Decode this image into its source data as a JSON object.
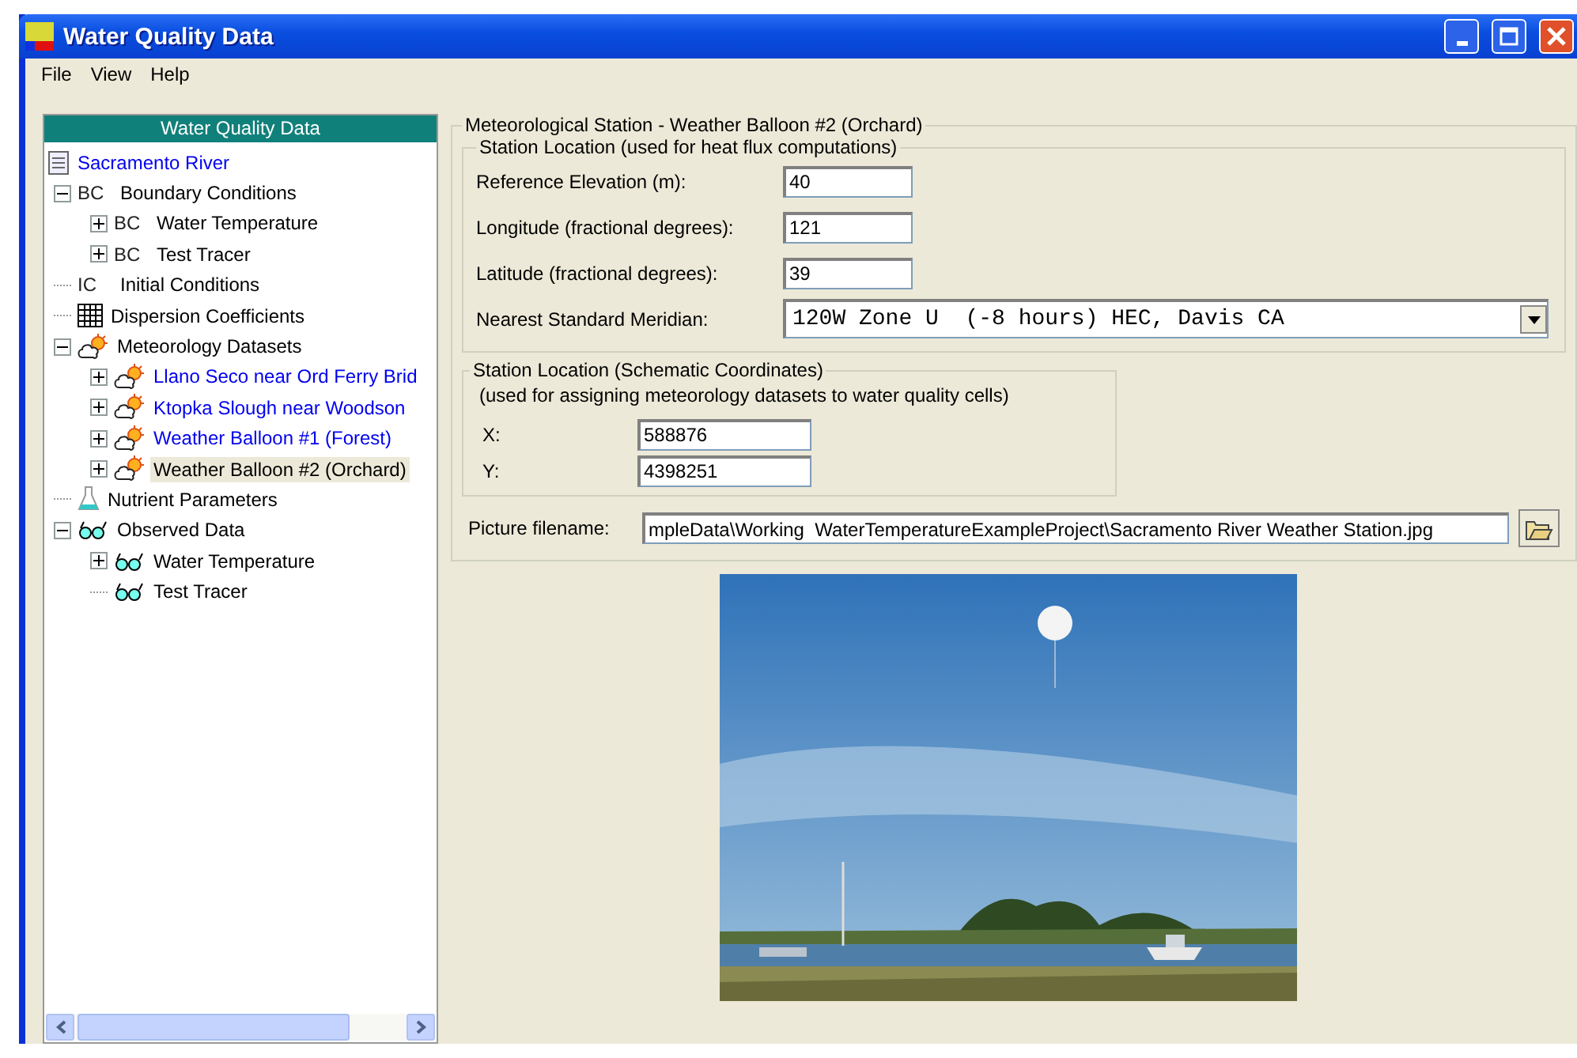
{
  "window": {
    "title": "Water Quality Data"
  },
  "menu": [
    "File",
    "View",
    "Help"
  ],
  "tree": {
    "title": "Water Quality Data",
    "items": [
      {
        "label": "Sacramento River",
        "kind": "document",
        "linked": true,
        "selected": false
      },
      {
        "label": "Boundary Conditions",
        "kind": "code",
        "badge": "BC",
        "linked": false,
        "selected": false,
        "expanded": true,
        "children": [
          {
            "label": "Water Temperature",
            "kind": "code",
            "badge": "BC",
            "linked": false,
            "selected": false,
            "expanded": false
          },
          {
            "label": "Test Tracer",
            "kind": "code",
            "badge": "BC",
            "linked": false,
            "selected": false,
            "expanded": false
          }
        ]
      },
      {
        "label": "Initial Conditions",
        "kind": "code",
        "badge": "IC",
        "linked": false,
        "selected": false
      },
      {
        "label": "Dispersion Coefficients",
        "kind": "grid",
        "linked": false,
        "selected": false
      },
      {
        "label": "Meteorology Datasets",
        "kind": "weather",
        "linked": false,
        "selected": false,
        "expanded": true,
        "children": [
          {
            "label": "Llano Seco near Ord Ferry Brid",
            "kind": "weather",
            "linked": true,
            "selected": false,
            "expanded": false
          },
          {
            "label": "Ktopka Slough near Woodson",
            "kind": "weather",
            "linked": true,
            "selected": false,
            "expanded": false
          },
          {
            "label": "Weather Balloon #1 (Forest)",
            "kind": "weather",
            "linked": true,
            "selected": false,
            "expanded": false
          },
          {
            "label": "Weather Balloon #2 (Orchard)",
            "kind": "weather",
            "linked": false,
            "selected": true,
            "expanded": false
          }
        ]
      },
      {
        "label": "Nutrient Parameters",
        "kind": "flask",
        "linked": false,
        "selected": false
      },
      {
        "label": "Observed Data",
        "kind": "glasses",
        "linked": false,
        "selected": false,
        "expanded": true,
        "children": [
          {
            "label": "Water Temperature",
            "kind": "glasses",
            "linked": false,
            "selected": false,
            "expanded": false
          },
          {
            "label": "Test Tracer",
            "kind": "glasses",
            "linked": false,
            "selected": false
          }
        ]
      }
    ]
  },
  "station": {
    "title": "Meteorological Station - Weather Balloon #2 (Orchard)",
    "location": {
      "title": "Station Location (used for heat flux computations)",
      "fields": [
        {
          "label": "Reference Elevation (m):",
          "value": "40"
        },
        {
          "label": "Longitude (fractional degrees):",
          "value": "121"
        },
        {
          "label": "Latitude (fractional degrees):",
          "value": "39"
        }
      ],
      "meridian": {
        "label": "Nearest Standard Meridian:",
        "value": "120W Zone U  (-8 hours) HEC, Davis CA"
      }
    },
    "schematic": {
      "title": "Station Location (Schematic Coordinates)",
      "note": "(used for assigning meteorology datasets to water quality cells)",
      "fields": [
        {
          "label": "X:",
          "value": "588876"
        },
        {
          "label": "Y:",
          "value": "4398251"
        }
      ]
    },
    "picture": {
      "label": "Picture filename:",
      "value": "mpleData\\Working  WaterTemperatureExampleProject\\Sacramento River Weather Station.jpg"
    }
  },
  "photo": {
    "kind": "picture"
  }
}
